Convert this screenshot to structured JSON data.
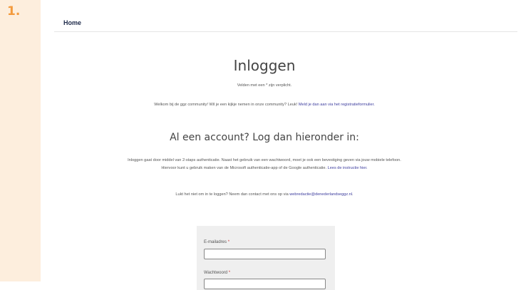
{
  "step": {
    "number": "1."
  },
  "breadcrumb": {
    "home_label": "Home"
  },
  "page": {
    "title": "Inloggen",
    "required_note": "Velden met een * zijn verplicht.",
    "welcome_text": "Welkom bij de ggz community! Wil je een kijkje nemen in onze community? Leuk! ",
    "welcome_link": "Meld je dan aan via het registratieformulier.",
    "subtitle": "Al een account? Log dan hieronder in:",
    "auth_text": "Inloggen gaat door middel van 2-staps authenticatie. Naast het gebruik van een wachtwoord, moet je ook een bevestiging geven via jouw mobiele telefoon. Hiervoor kunt u gebruik maken van de Microsoft authenticatie-app of de Google authenticatie. ",
    "auth_link": "Lees de instructie hier.",
    "contact_text": "Lukt het niet om in te loggen? Neem dan contact met ons op via ",
    "contact_link": "webredactie@denederlandseggz.nl",
    "contact_suffix": "."
  },
  "form": {
    "email_label": "E-mailadres",
    "email_value": "",
    "password_label": "Wachtwoord",
    "password_value": "",
    "required_mark": "*"
  },
  "colors": {
    "step_strip": "#fdeedd",
    "step_number": "#f39a3d",
    "link": "#3d3d9e",
    "form_panel": "#efefef"
  }
}
